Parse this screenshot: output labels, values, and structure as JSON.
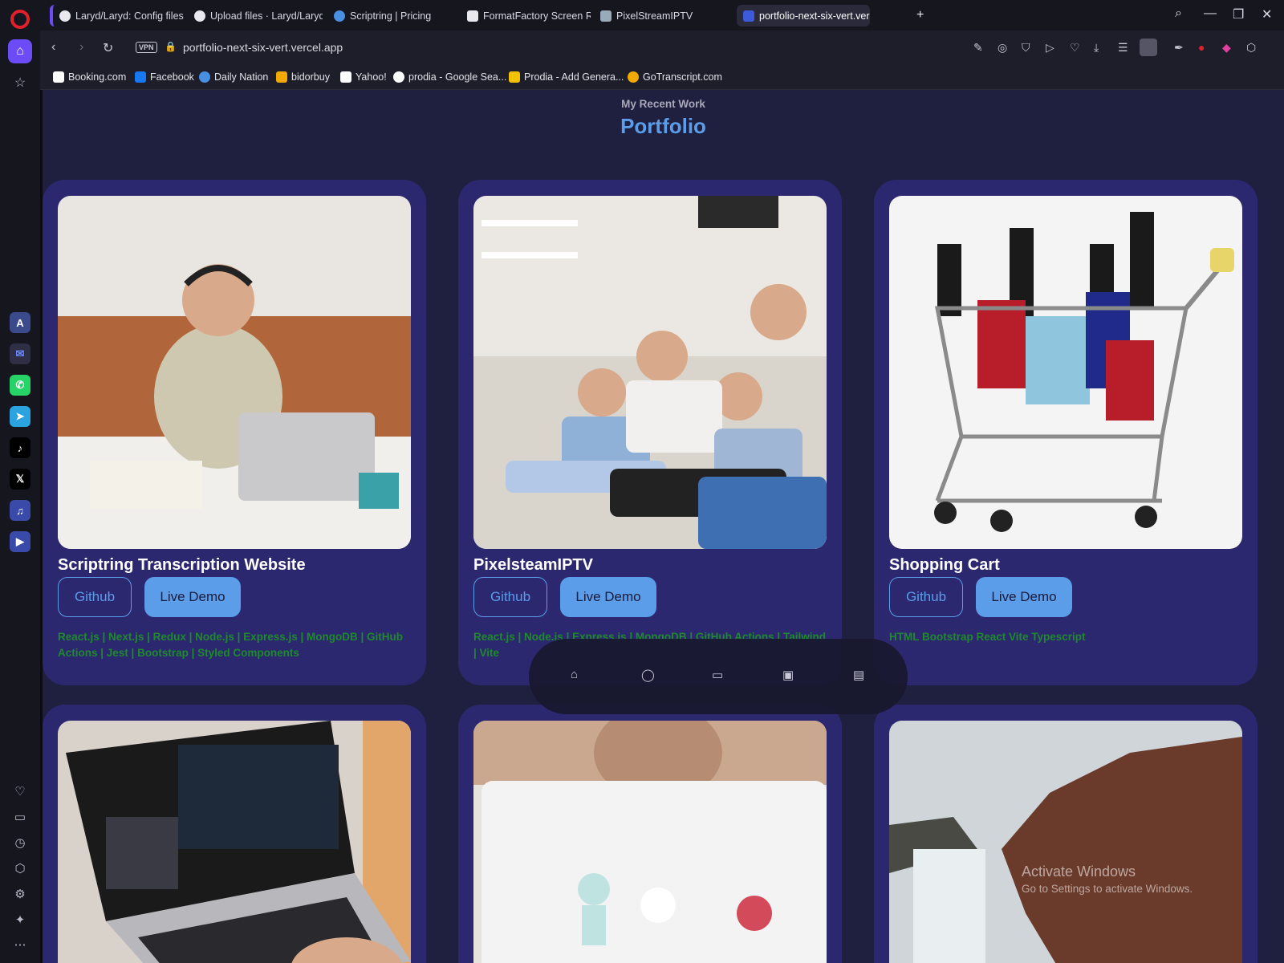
{
  "tabs": [
    {
      "label": "Laryd/Laryd: Config files fo",
      "fav": "github-icon"
    },
    {
      "label": "Upload files · Laryd/Laryd",
      "fav": "github-icon"
    },
    {
      "label": "Scriptring | Pricing",
      "fav": "scriptring-icon"
    },
    {
      "label": "FormatFactory Screen Rec",
      "fav": "formatfactory-icon"
    },
    {
      "label": "PixelStreamIPTV",
      "fav": "pixelstream-icon"
    },
    {
      "label": "portfolio-next-six-vert.verc",
      "fav": "portfolio-icon"
    }
  ],
  "address": {
    "vpn": "VPN",
    "url_host": "portfolio-next-six-vert",
    "url_tld": ".vercel.app"
  },
  "bookmarks": [
    {
      "label": "Booking.com",
      "color": "#ffffff"
    },
    {
      "label": "Facebook",
      "color": "#1877f2"
    },
    {
      "label": "Daily Nation",
      "color": "#4a90e2"
    },
    {
      "label": "bidorbuy",
      "color": "#f2a900"
    },
    {
      "label": "Yahoo!",
      "color": "#ffffff"
    },
    {
      "label": "prodia - Google Sea...",
      "color": "#ffffff"
    },
    {
      "label": "Prodia - Add Genera...",
      "color": "#f2c200"
    },
    {
      "label": "GoTranscript.com",
      "color": "#f2a900"
    }
  ],
  "page": {
    "subtitle": "My Recent Work",
    "title": "Portfolio",
    "projects": [
      {
        "title": "Scriptring Transcription Website",
        "github": "Github",
        "demo": "Live Demo",
        "tech": "React.js | Next.js | Redux | Node.js | Express.js | MongoDB | GitHub Actions | Jest | Bootstrap | Styled Components"
      },
      {
        "title": "PixelsteamIPTV",
        "github": "Github",
        "demo": "Live Demo",
        "tech": "React.js | Node.js | Express.js | MongoDB | GitHub Actions | Tailwind | Vite"
      },
      {
        "title": "Shopping Cart",
        "github": "Github",
        "demo": "Live Demo",
        "tech": "HTML Bootstrap React Vite Typescript"
      }
    ]
  },
  "watermark": {
    "line1": "Activate Windows",
    "line2": "Go to Settings to activate Windows."
  },
  "colors": {
    "accent": "#5b9de8",
    "card": "#2c2870",
    "background": "#1f1f3f",
    "tech": "#1e8a2a"
  }
}
